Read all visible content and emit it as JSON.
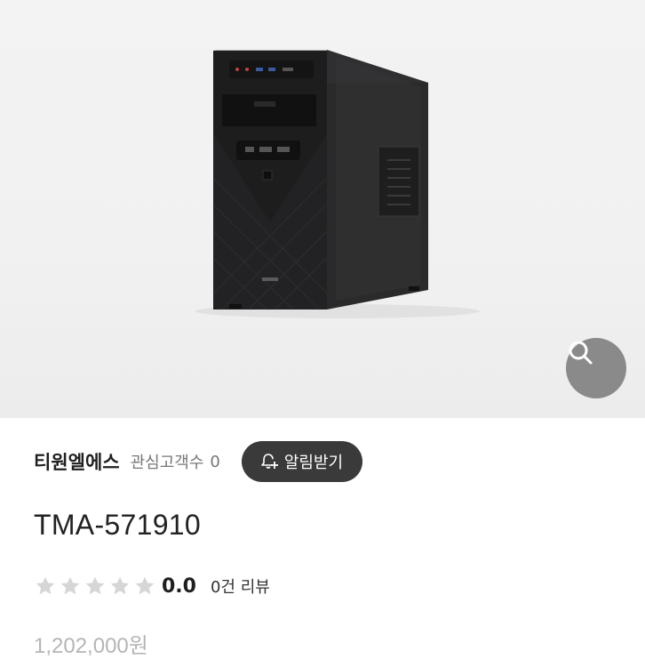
{
  "product": {
    "image_alt": "TMA-571910 PC case",
    "title": "TMA-571910",
    "price": "1,202,000원"
  },
  "seller": {
    "name": "티원엘에스",
    "watchers_label": "관심고객수",
    "watchers_count": "0",
    "alert_button_label": "알림받기"
  },
  "rating": {
    "score": "0.0",
    "stars_filled": 0,
    "stars_total": 5,
    "review_count_label": "0건 리뷰"
  },
  "icons": {
    "zoom": "magnifier-icon",
    "alert": "bell-plus-icon",
    "star": "star-icon"
  },
  "colors": {
    "alert_button_bg": "#3a3a3a",
    "star_empty": "#d6d6d6",
    "price_text": "#b5b5b5"
  }
}
